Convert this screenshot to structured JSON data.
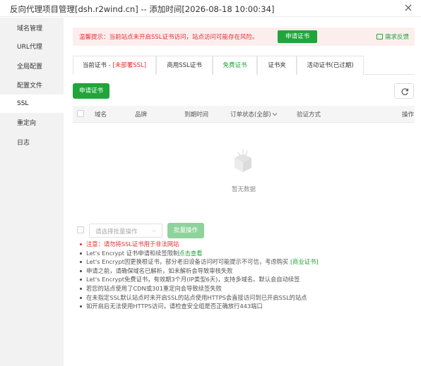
{
  "window": {
    "title": "反向代理项目管理[dsh.r2wind.cn] -- 添加时间[2026-08-18 10:00:34]"
  },
  "sidebar": {
    "items": [
      {
        "label": "域名管理"
      },
      {
        "label": "URL代理"
      },
      {
        "label": "全局配置"
      },
      {
        "label": "配置文件"
      },
      {
        "label": "SSL"
      },
      {
        "label": "重定向"
      },
      {
        "label": "日志"
      }
    ],
    "active": "SSL"
  },
  "alert": {
    "message": "温馨提示：当前站点未开启SSL证书访问，站点访问可能存在风险。",
    "apply_button": "申请证书",
    "feedback": "需求反馈"
  },
  "tabs": [
    {
      "label": "当前证书 - ",
      "extra": "[未部署SSL]"
    },
    {
      "label": "商用SSL证书"
    },
    {
      "label": "免费证书"
    },
    {
      "label": "证书夹"
    },
    {
      "label": "活动证书(已过期)"
    }
  ],
  "active_tab": "免费证书",
  "toolbar": {
    "apply_button": "申请证书"
  },
  "table": {
    "columns": [
      "域名",
      "品牌",
      "到期时间",
      "订单状态(全部)",
      "验证方式",
      "操作"
    ],
    "rows": [],
    "empty_text": "暂无数据"
  },
  "batch": {
    "placeholder": "请选择批量操作",
    "button": "批量操作"
  },
  "notes": [
    {
      "text": "注意：请勿将SSL证书用于非法网站",
      "style": "warn"
    },
    {
      "text": "Let's Encrypt 证书申请和续签限制",
      "link": "点击查看"
    },
    {
      "text": "Let's Encrypt因更换根证书，部分老旧设备访问时可能提示不可信，考虑购买 ",
      "link": "[商业证书]"
    },
    {
      "text": "申请之前，请确保域名已解析，如未解析会导致审核失败"
    },
    {
      "text": "Let's Encrypt免费证书，有效期3个月(IP类型6天)，支持多域名。默认会自动续签"
    },
    {
      "text": "若您的站点使用了CDN或301重定向会导致续签失败"
    },
    {
      "text": "在未指定SSL默认站点时未开启SSL的站点使用HTTPS会直接访问到已开启SSL的站点"
    },
    {
      "text": "如开启后无法使用HTTPS访问，请检查安全组是否正确放行443端口"
    }
  ],
  "colors": {
    "primary": "#20a53a",
    "danger": "#e2312f",
    "disabled": "#8ed39c",
    "sidebar_bg": "#f2f2f2"
  },
  "icons": {
    "close": "close-icon",
    "refresh": "refresh-icon",
    "feedback": "feedback-icon",
    "empty": "empty-box-icon",
    "chevron": "chevron-down-icon"
  }
}
